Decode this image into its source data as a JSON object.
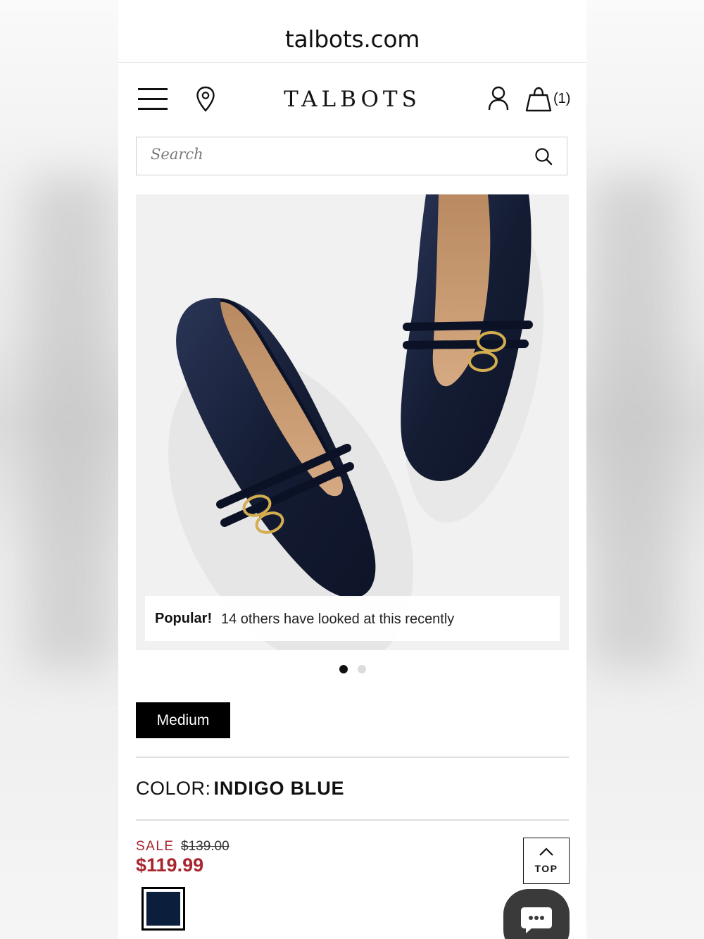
{
  "browser": {
    "url": "talbots.com"
  },
  "header": {
    "logo": "TALBOTS",
    "cart_count": "(1)",
    "icons": [
      "menu-icon",
      "location-pin-icon",
      "account-icon",
      "shopping-bag-icon"
    ]
  },
  "search": {
    "placeholder": "Search"
  },
  "hero": {
    "popular_strong": "Popular!",
    "popular_text": "14 others have looked at this recently",
    "carousel_pages": 2,
    "carousel_active": 1
  },
  "product": {
    "size_option": "Medium",
    "color_label": "COLOR:",
    "color_value": "INDIGO BLUE",
    "sale_label": "SALE",
    "original_price": "$139.00",
    "sale_price": "$119.99",
    "swatch_color": "#0b1f3d"
  },
  "floating": {
    "top_label": "TOP"
  },
  "colors": {
    "sale_red": "#a8252f",
    "shoe_navy": "#1b2540"
  }
}
